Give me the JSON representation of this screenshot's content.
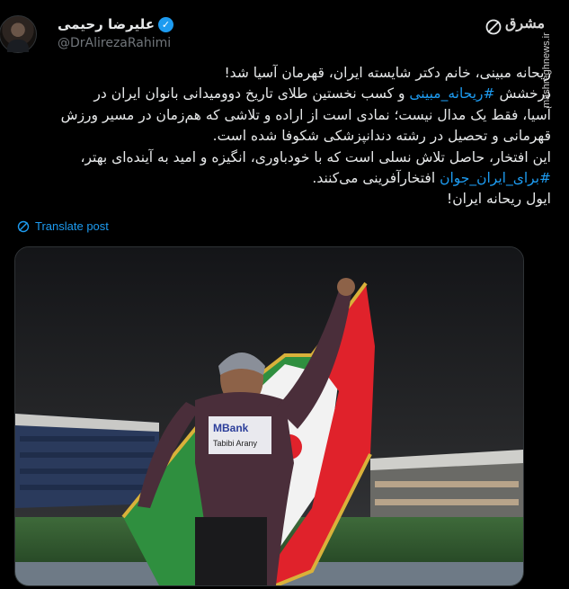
{
  "author": {
    "display_name": "علیرضا رحیمی",
    "handle": "@DrAlirezaRahimi",
    "verified": true,
    "verified_color": "#1d9bf0"
  },
  "tweet": {
    "lines": [
      [
        {
          "text": "ریحانه مبینی، خانم دکتر شایسته ایران، قهرمان آسیا شد!",
          "hashtag": false
        }
      ],
      [
        {
          "text": "درخشش ",
          "hashtag": false
        },
        {
          "text": "#ریحانه_مبینی",
          "hashtag": true
        },
        {
          "text": " و کسب نخستین طلای تاریخ دوومیدانی بانوان ایران در",
          "hashtag": false
        }
      ],
      [
        {
          "text": "آسیا، فقط یک مدال نیست؛ نمادی است از اراده و تلاشی که هم‌زمان در مسیر ورزش",
          "hashtag": false
        }
      ],
      [
        {
          "text": "قهرمانی و تحصیل در رشته دندانپزشکی شکوفا شده است.",
          "hashtag": false
        }
      ],
      [
        {
          "text": "این افتخار، حاصل تلاش نسلی است که با خودباوری، انگیزه و امید به آینده‌ای بهتر،",
          "hashtag": false
        }
      ],
      [
        {
          "text": "#برای_ایران_جوان",
          "hashtag": true
        },
        {
          "text": " افتخارآفرینی می‌کنند.",
          "hashtag": false
        }
      ],
      [
        {
          "text": "ایول ریحانه ایران!",
          "hashtag": false
        }
      ]
    ]
  },
  "translate_label": "Translate post",
  "media": {
    "bib_text": "MBank",
    "bib_name": "Tabibi Arany"
  },
  "branding": {
    "logo": "مشرق",
    "watermark": "mashreghnews.ir"
  },
  "colors": {
    "background": "#000000",
    "text": "#e7e9ea",
    "secondary": "#71767b",
    "accent": "#1d9bf0"
  }
}
